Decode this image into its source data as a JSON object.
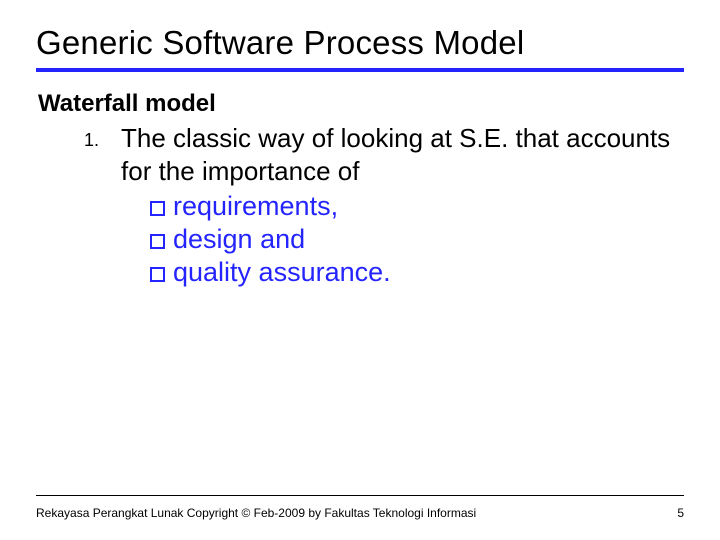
{
  "title": "Generic Software Process Model",
  "subtitle": "Waterfall model",
  "list": {
    "marker": "1.",
    "text": "The classic way of looking at S.E. that accounts for the importance of"
  },
  "bullets": [
    "requirements,",
    "design and",
    "quality assurance."
  ],
  "footer": {
    "left": "Rekayasa Perangkat Lunak Copyright © Feb-2009 by Fakultas Teknologi Informasi",
    "right": "5"
  }
}
